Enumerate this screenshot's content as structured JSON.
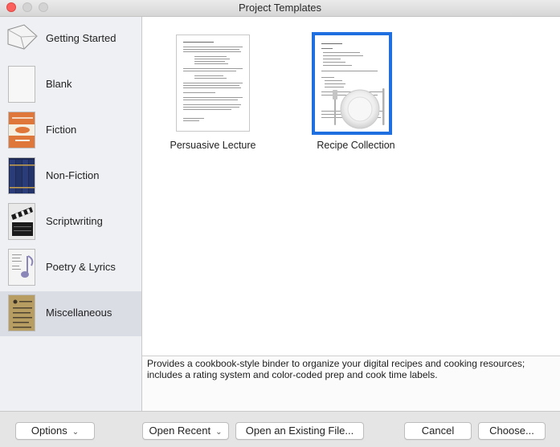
{
  "window": {
    "title": "Project Templates"
  },
  "sidebar": {
    "items": [
      {
        "label": "Getting Started",
        "icon": "envelope-icon"
      },
      {
        "label": "Blank",
        "icon": "blank-page-icon"
      },
      {
        "label": "Fiction",
        "icon": "fiction-book-icon"
      },
      {
        "label": "Non-Fiction",
        "icon": "bookshelf-icon"
      },
      {
        "label": "Scriptwriting",
        "icon": "clapperboard-icon"
      },
      {
        "label": "Poetry & Lyrics",
        "icon": "music-note-icon"
      },
      {
        "label": "Miscellaneous",
        "icon": "notebook-icon"
      }
    ],
    "selected": "Miscellaneous"
  },
  "templates": [
    {
      "label": "Persuasive Lecture"
    },
    {
      "label": "Recipe Collection",
      "selected": true
    }
  ],
  "description": "Provides a cookbook-style binder to organize your digital recipes and cooking resources; includes a rating system and color-coded prep and cook time labels.",
  "buttons": {
    "options": "Options",
    "open_recent": "Open Recent",
    "open_existing": "Open an Existing File...",
    "cancel": "Cancel",
    "choose": "Choose..."
  },
  "colors": {
    "selection_border": "#1f6fe0",
    "close": "#fc605c",
    "sidebar_selected": "#dadde4"
  }
}
